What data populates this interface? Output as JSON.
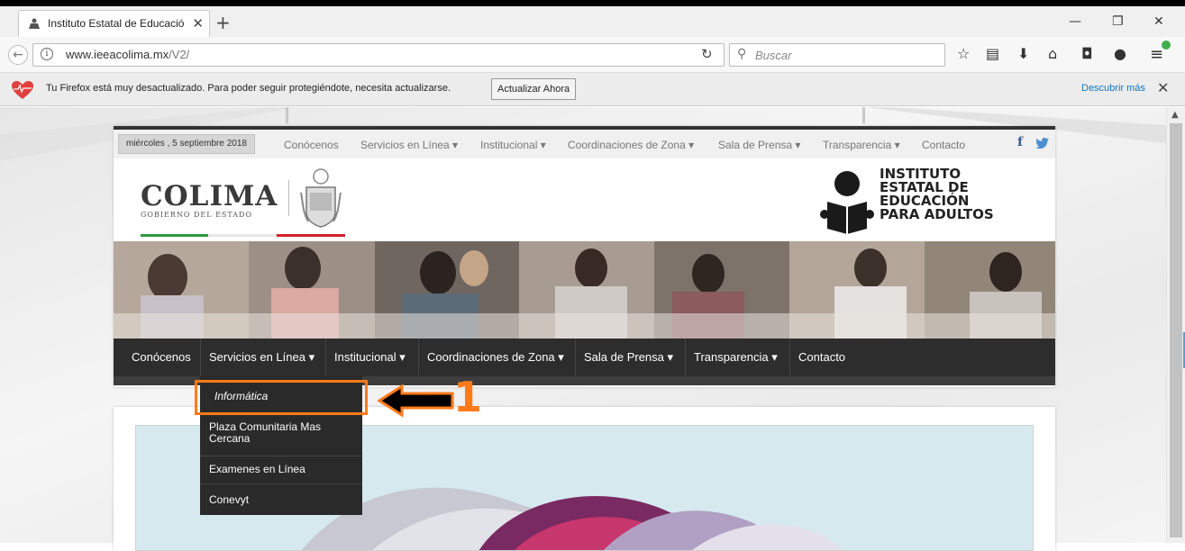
{
  "browser": {
    "tab_title": "Instituto Estatal de Educació",
    "url_host": "www.ieeacolima.mx",
    "url_path": "/V2/",
    "search_placeholder": "Buscar"
  },
  "notification": {
    "message": "Tu Firefox está muy desactualizado. Para poder seguir protegiéndote, necesita actualizarse.",
    "button": "Actualizar Ahora",
    "link": "Descubrir más"
  },
  "site": {
    "date": "miércoles , 5 septiembre 2018",
    "top_menu": [
      "Conócenos",
      "Servicios en Línea ▾",
      "Institucional ▾",
      "Coordinaciones de Zona ▾",
      "Sala de Prensa ▾",
      "Transparencia ▾",
      "Contacto"
    ],
    "colima_title": "COLIMA",
    "colima_subtitle": "GOBIERNO DEL ESTADO",
    "institute_lines": [
      "INSTITUTO",
      "ESTATAL DE",
      "EDUCACIÓN",
      "PARA ADULTOS"
    ],
    "main_menu": [
      "Conócenos",
      "Servicios en Línea ▾",
      "Institucional ▾",
      "Coordinaciones de Zona ▾",
      "Sala de Prensa ▾",
      "Transparencia ▾",
      "Contacto"
    ],
    "dropdown": [
      "Informática",
      "Plaza Comunitaria Mas Cercana",
      "Examenes en Línea",
      "Conevyt"
    ]
  },
  "annotation": {
    "number": "1",
    "color": "#ff7a1a"
  },
  "icons": [
    "firefox-tab-icon",
    "close-icon",
    "plus-icon",
    "back-icon",
    "info-icon",
    "reload-icon",
    "search-icon",
    "star-icon",
    "reading-list-icon",
    "download-icon",
    "home-icon",
    "pocket-icon",
    "extension-icon",
    "menu-icon",
    "heart-icon",
    "facebook-icon",
    "twitter-icon"
  ]
}
